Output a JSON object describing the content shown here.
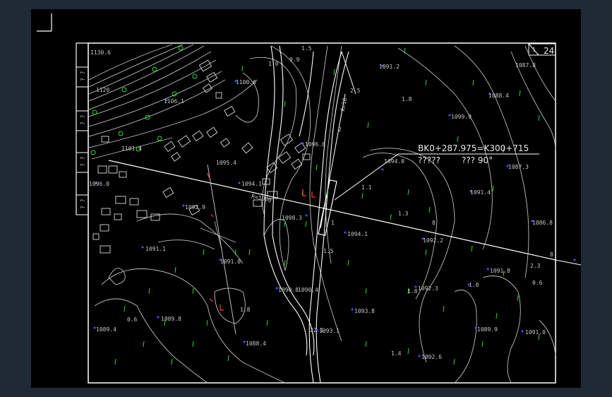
{
  "window": {
    "background": "#1f2a36",
    "viewport_background": "#000000"
  },
  "drawing": {
    "annotation": {
      "station": "BK0+287.975=K300+715",
      "left_text": "?????",
      "right_text": "??? 90°"
    },
    "sheet_number": "24",
    "corner_mark": "1",
    "side_stamps": [
      "? ?",
      "? ?",
      "? ?",
      "? ?"
    ],
    "road_labels": [
      "R=1000",
      "R=10"
    ],
    "elevations": [
      "1130.6",
      "1120",
      "1106.1",
      "1100.6",
      "1101.4",
      "1096.8",
      "1096.0",
      "1095.4",
      "1094.1",
      "1094.0",
      "1093.8",
      "1093.1",
      "1092.9",
      "1092.3",
      "1092.2",
      "1091.8",
      "1091.4",
      "1091.2",
      "1091.1",
      "1091.0",
      "1091.0",
      "1090.8",
      "1090.4",
      "1089.9",
      "1089.8",
      "1089.4",
      "1088.4",
      "1088.4",
      "1087.8",
      "1087.3",
      "1086.8",
      "1098.3",
      "1099.9",
      "1094.1",
      "1092.6"
    ],
    "spot_values": [
      "1.5",
      "1.0",
      "0.9",
      "1.8",
      "1.1",
      "1.3",
      "8",
      "2.3",
      "1.0",
      "0.6",
      "1.8",
      "1.5",
      "1.4",
      "1.8",
      "0.6",
      "2.5",
      "2",
      "1",
      "8",
      "22.1"
    ],
    "colors": {
      "background": "#000000",
      "contour": "#bdbdbd",
      "frame": "#ffffff",
      "vegetation": "#39d839",
      "points": "#3b5cff",
      "markers": "#ff3a3a"
    }
  }
}
